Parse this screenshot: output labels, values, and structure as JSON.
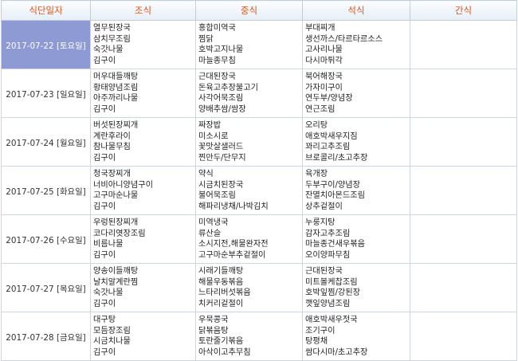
{
  "headers": {
    "date": "식단일자",
    "breakfast": "조식",
    "lunch": "중식",
    "dinner": "석식",
    "snack": "간식"
  },
  "selected_date_index": 0,
  "days": [
    {
      "date": "2017-07-22 [토요일]",
      "breakfast": [
        "열무된장국",
        "삼치무조림",
        "숙갓나물",
        "김구이"
      ],
      "lunch": [
        "홍합미역국",
        "찜닭",
        "호박고지나물",
        "마늘종무침"
      ],
      "dinner": [
        "부대찌개",
        "생선까스/타르타르소스",
        "고사리나물",
        "다시마튀각"
      ],
      "snack": []
    },
    {
      "date": "2017-07-23 [일요일]",
      "breakfast": [
        "머우대들깨탕",
        "황태양념조림",
        "아주까리나물",
        "김구이"
      ],
      "lunch": [
        "근대된장국",
        "돈육고추장불고기",
        "사각어묵조림",
        "양배추쌈/쌈장"
      ],
      "dinner": [
        "북어해장국",
        "가자미구이",
        "연두부/양념장",
        "연근조림"
      ],
      "snack": []
    },
    {
      "date": "2017-07-24 [월요일]",
      "breakfast": [
        "버섯된장찌개",
        "계란후라이",
        "참나물무침",
        "김구이"
      ],
      "lunch": [
        "짜장밥",
        "미소시로",
        "꽃맛살샐러드",
        "찐만두/단무지"
      ],
      "dinner": [
        "오리탕",
        "애호박새우지짐",
        "꽈리고추조림",
        "브로콜리/초고추장"
      ],
      "snack": []
    },
    {
      "date": "2017-07-25 [화요일]",
      "breakfast": [
        "청국장찌개",
        "너비아니양념구이",
        "고구마순나물",
        "김구이"
      ],
      "lunch": [
        "약식",
        "시금치된장국",
        "불어묵조림",
        "해파리냉채/나박김치"
      ],
      "dinner": [
        "육개장",
        "두부구이/양념장",
        "잔멸치아몬드조림",
        "상추겉절이"
      ],
      "snack": []
    },
    {
      "date": "2017-07-26 [수요일]",
      "breakfast": [
        "우렁된장찌개",
        "코다리엿장조림",
        "비름나물",
        "김구이"
      ],
      "lunch": [
        "미역냉국",
        "류산슬",
        "소시지전,해물완자전",
        "고구마순부추겉절이"
      ],
      "dinner": [
        "누룽지탕",
        "감자고추조림",
        "마늘종건새우볶음",
        "오이양파무침"
      ],
      "snack": []
    },
    {
      "date": "2017-07-27 [목요일]",
      "breakfast": [
        "양송이들깨탕",
        "날치알계란찜",
        "숙갓나물",
        "김구이"
      ],
      "lunch": [
        "시래기들깨탕",
        "해물우동볶음",
        "느타리버섯볶음",
        "치커리겉절이"
      ],
      "dinner": [
        "근대된장국",
        "미트볼케찹조림",
        "호박잎찜/강된장",
        "깻잎양념조림"
      ],
      "snack": []
    },
    {
      "date": "2017-07-28 [금요일]",
      "breakfast": [
        "대구탕",
        "모듬장조림",
        "시금치나물",
        "김구이"
      ],
      "lunch": [
        "우묵콩국",
        "닭볶음탕",
        "토란줄기볶음",
        "아삭이고추무침"
      ],
      "dinner": [
        "애호박새우젓국",
        "조기구이",
        "탕평채",
        "쌈다시마/초고추장"
      ],
      "snack": []
    }
  ]
}
